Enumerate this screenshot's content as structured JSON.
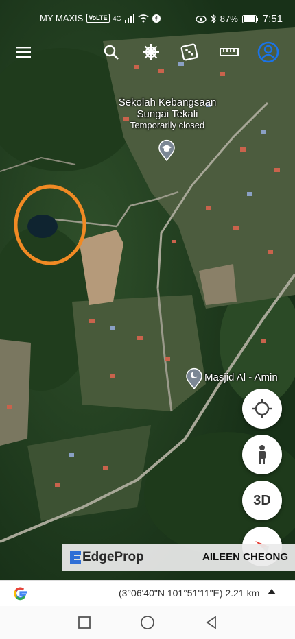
{
  "status_bar": {
    "carrier": "MY MAXIS",
    "volte": "VoLTE",
    "network": "4G",
    "battery": "87%",
    "time": "7:51"
  },
  "toolbar": {
    "icons": [
      "menu-icon",
      "search-icon",
      "ship-wheel-icon",
      "dice-icon",
      "ruler-icon",
      "account-icon"
    ],
    "accent_color": "#1a73e8"
  },
  "map": {
    "places": {
      "school_name_line1": "Sekolah Kebangsaan",
      "school_name_line2": "Sungai Tekali",
      "school_status": "Temporarily closed",
      "mosque": "Masjid Al - Amin"
    },
    "highlight_color": "#f08a24"
  },
  "controls": {
    "three_d": "3D"
  },
  "banner": {
    "brand_edge": "Edge",
    "brand_prop": "Prop",
    "agent": "AILEEN CHEONG"
  },
  "bottom_bar": {
    "google_letter": "G",
    "coordinates": "(3°06'40\"N 101°51'11\"E) 2.21 km"
  }
}
